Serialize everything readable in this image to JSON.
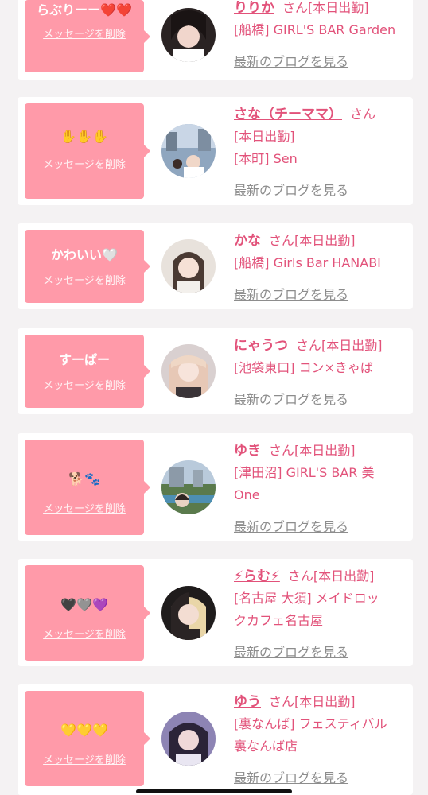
{
  "common": {
    "san": "さん",
    "delete_label": "メッセージを削除",
    "blog_label": "最新のブログを見る"
  },
  "cards": [
    {
      "message": "らぶりーー❤️❤️",
      "name": "りりか",
      "lines": [
        "[本日出勤]",
        "[船橋] GIRL'S BAR Garden"
      ]
    },
    {
      "message": "✋✋✋",
      "name": "さな（チーママ）",
      "lines": [
        "[本日出勤]",
        "[本町] Sen"
      ]
    },
    {
      "message": "かわいい🤍",
      "name": "かな",
      "lines": [
        "[本日出勤]",
        "[船橋] Girls Bar HANABI"
      ]
    },
    {
      "message": "すーぱー",
      "name": "にゃうつ",
      "lines": [
        "[本日出勤]",
        "[池袋東口] コン×きゃば"
      ]
    },
    {
      "message": "🐕🐾",
      "name": "ゆき",
      "lines": [
        "[本日出勤]",
        "[津田沼] GIRL'S BAR 美",
        "One"
      ]
    },
    {
      "message": "🖤🩶💜",
      "name": "⚡らむ⚡",
      "lines": [
        "[本日出勤]",
        "[名古屋 大須] メイドロッ",
        "クカフェ名古屋"
      ]
    },
    {
      "message": "💛💛💛",
      "name": "ゆう",
      "lines": [
        "[本日出勤]",
        "[裏なんば] フェスティバル",
        "裏なんば店"
      ]
    }
  ]
}
